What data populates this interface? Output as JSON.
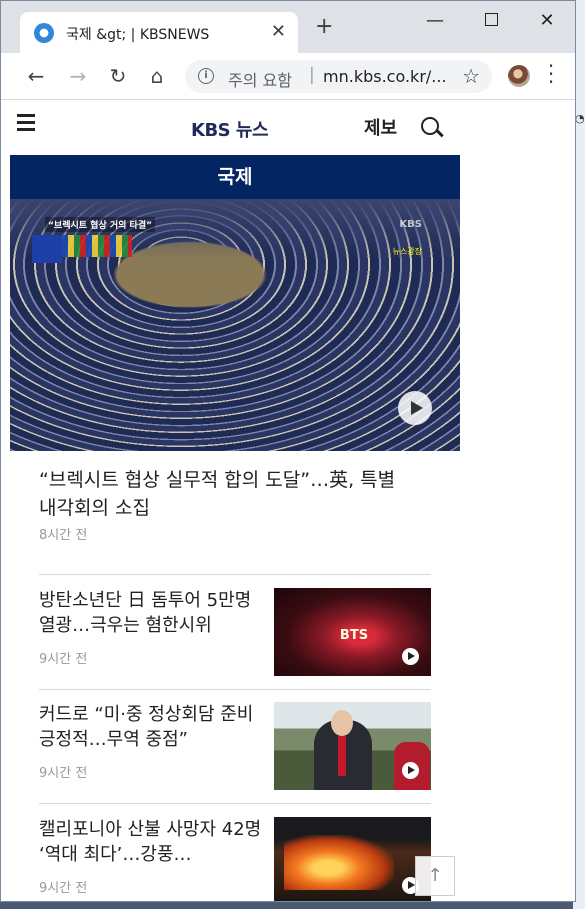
{
  "browser": {
    "tab_title": "국제 &gt; | KBSNEWS",
    "new_tab_label": "+",
    "window_controls": {
      "minimize": "—",
      "close": "✕"
    },
    "omnibox": {
      "status": "주의 요함",
      "separator": "|",
      "url": "mn.kbs.co.kr/..."
    }
  },
  "site": {
    "logo": "KBS 뉴스",
    "report_label": "제보",
    "section_title": "국제"
  },
  "top_story": {
    "title": "“브렉시트 협상 실무적 합의 도달”…英, 특별내각회의 소집",
    "time": "8시간 전",
    "image_caption": "“브렉시트 협상 거의 타결”",
    "image_watermark": "KBS",
    "image_badge": "뉴스광장"
  },
  "list": [
    {
      "title": "방탄소년단 日 돔투어 5만명 열광…극우는 혐한시위",
      "time": "9시간 전",
      "thumb_text": "BTS"
    },
    {
      "title": "커드로 “미·중 정상회담 준비 긍정적…무역 중점”",
      "time": "9시간 전"
    },
    {
      "title": "캘리포니아 산불 사망자 42명 ‘역대 최다’…강풍…",
      "time": "9시간 전"
    }
  ],
  "scroll_top_label": "↑",
  "icons": [
    "favicon-icon",
    "close-icon",
    "back-icon",
    "forward-icon",
    "reload-icon",
    "home-icon",
    "info-icon",
    "star-icon",
    "menu-icon",
    "hamburger-icon",
    "search-icon",
    "play-icon",
    "arrow-up-icon"
  ],
  "colors": {
    "section_bar": "#032561",
    "logo": "#1f2a5c",
    "time_text": "#999999"
  }
}
